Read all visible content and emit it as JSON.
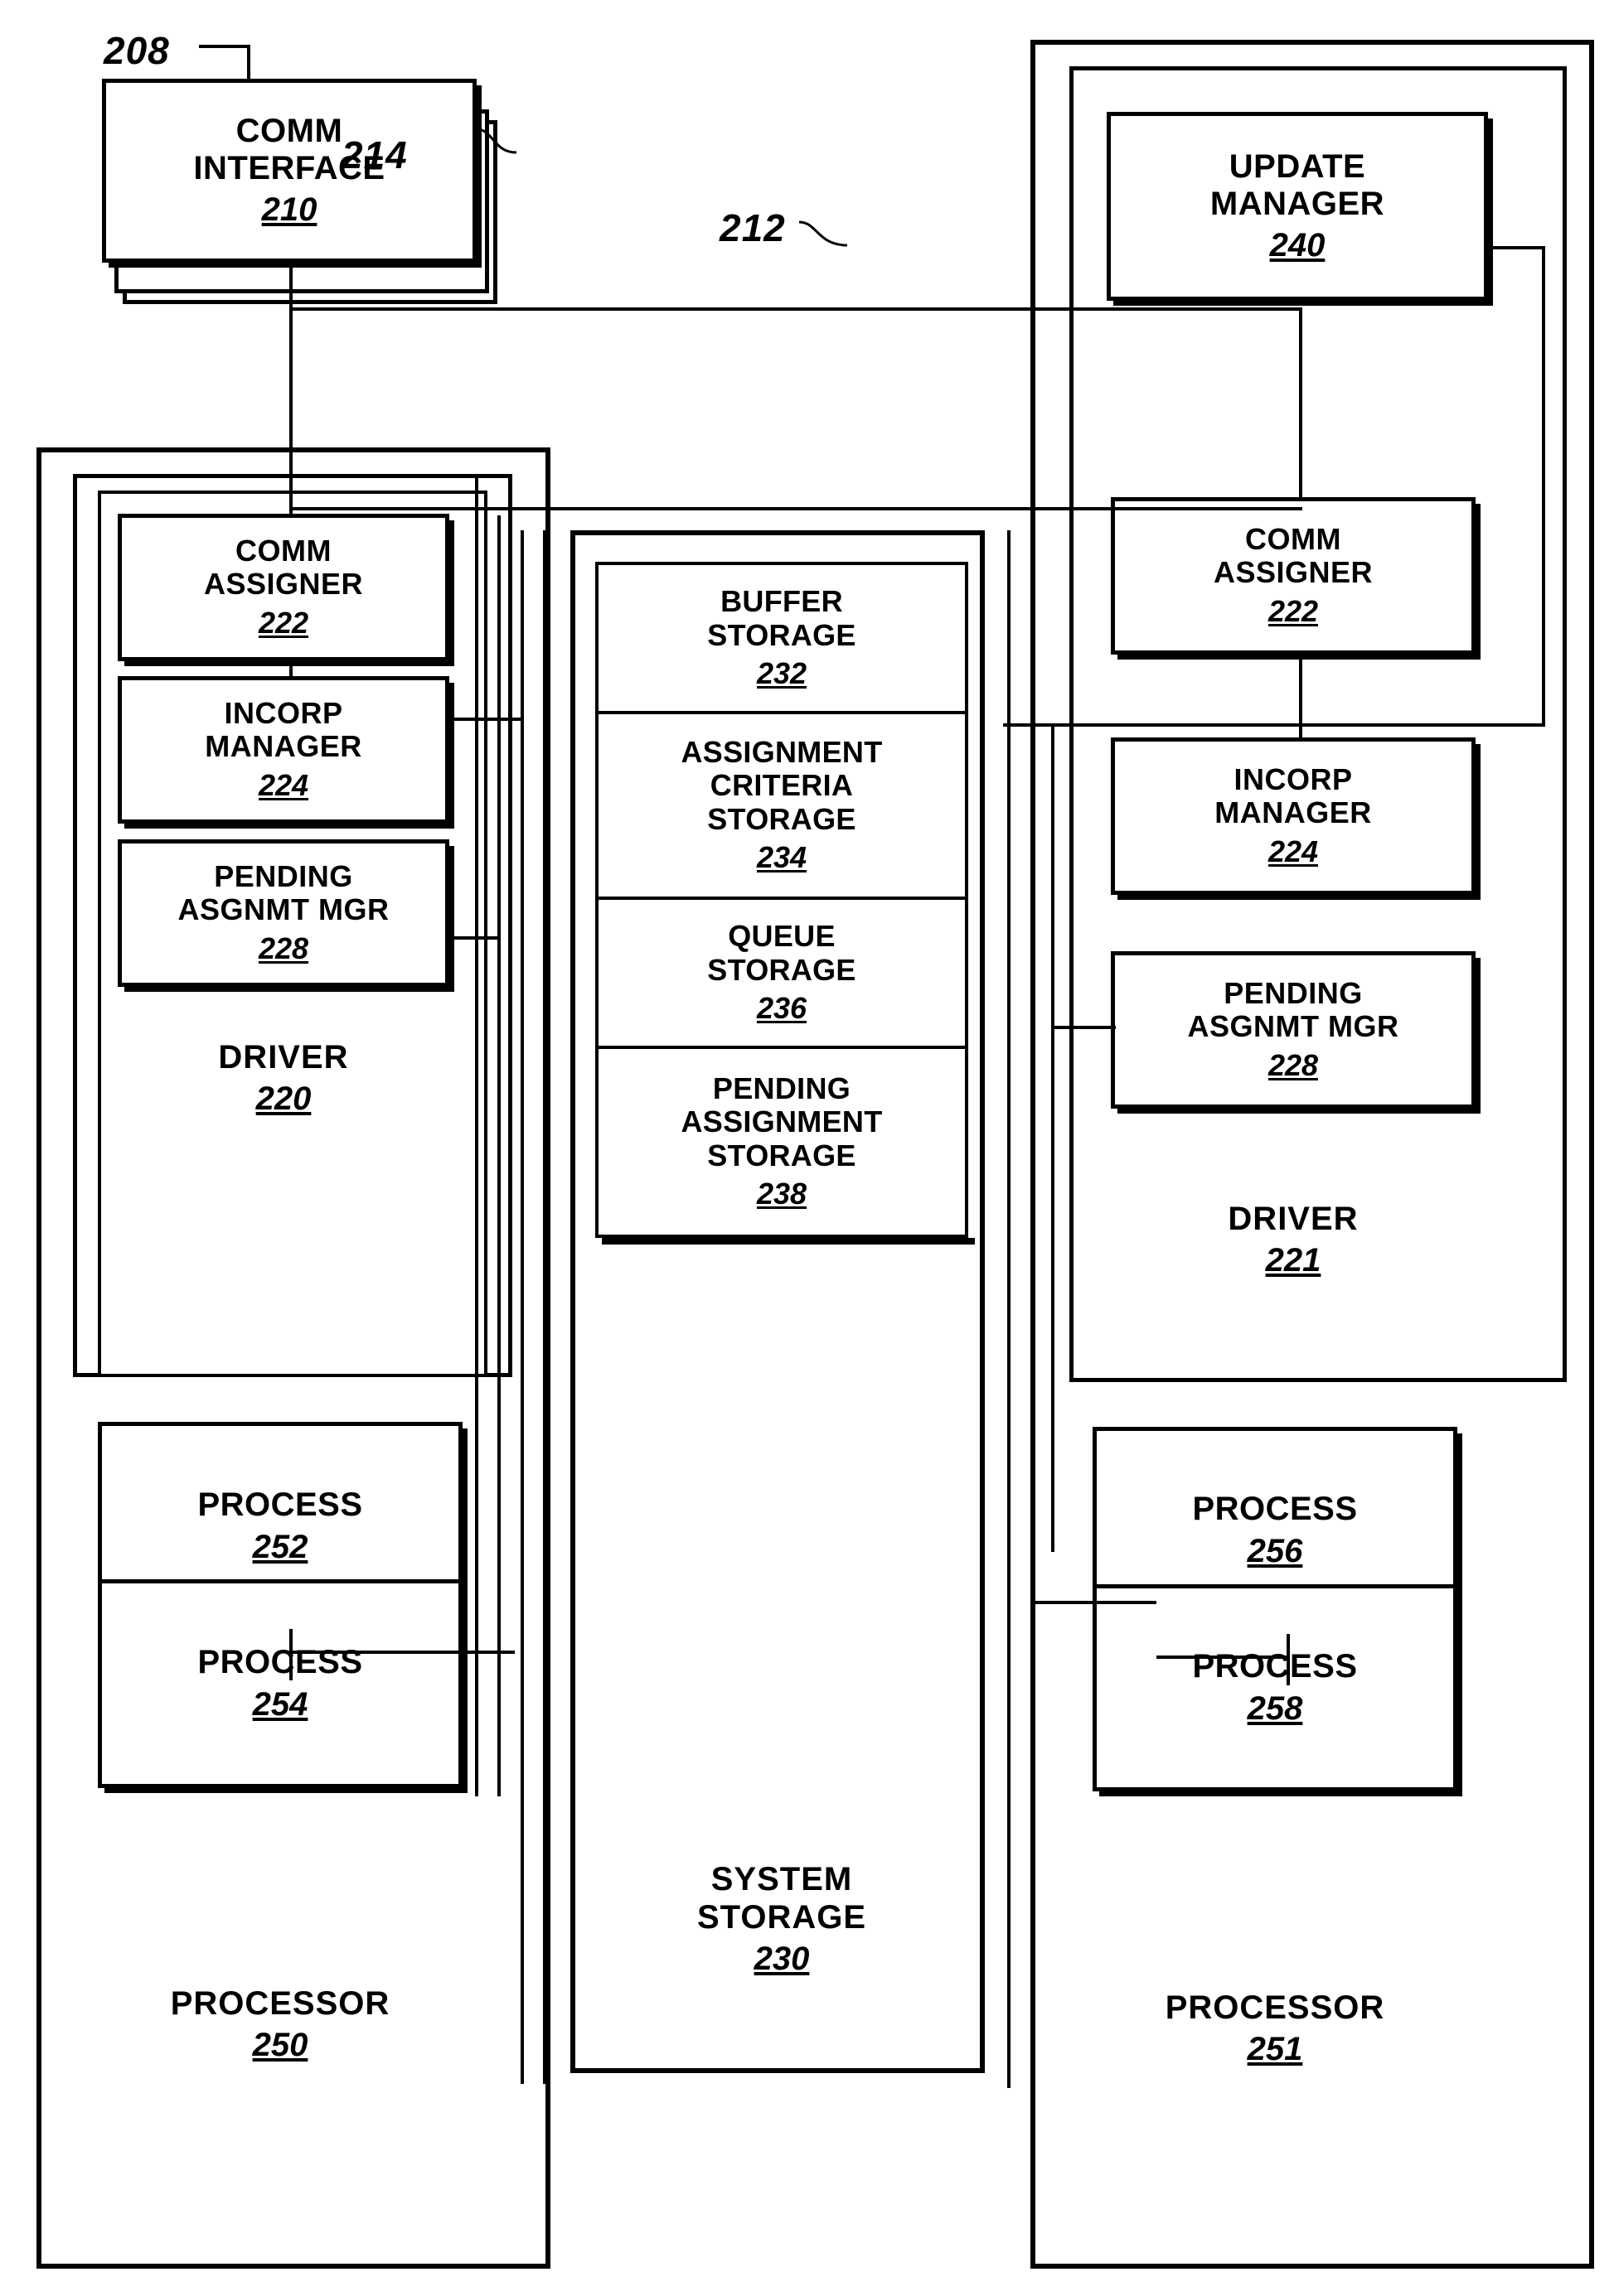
{
  "figure": {
    "callouts": [
      {
        "id": "208",
        "label": "208"
      },
      {
        "id": "212",
        "label": "212"
      },
      {
        "id": "214",
        "label": "214"
      }
    ]
  },
  "comm_interface": {
    "title": "COMM\nINTERFACE",
    "number": "210"
  },
  "update_manager": {
    "title": "UPDATE\nMANAGER",
    "number": "240"
  },
  "left_processor": {
    "caption_title": "PROCESSOR",
    "caption_number": "250",
    "driver": {
      "caption_title": "DRIVER",
      "caption_number": "220",
      "modules": [
        {
          "title": "COMM\nASSIGNER",
          "number": "222"
        },
        {
          "title": "INCORP\nMANAGER",
          "number": "224"
        },
        {
          "title": "PENDING\nASGNMT MGR",
          "number": "228"
        }
      ]
    },
    "processes": [
      {
        "title": "PROCESS",
        "number": "252"
      },
      {
        "title": "PROCESS",
        "number": "254"
      }
    ]
  },
  "right_processor": {
    "caption_title": "PROCESSOR",
    "caption_number": "251",
    "driver": {
      "caption_title": "DRIVER",
      "caption_number": "221",
      "modules": [
        {
          "title": "COMM\nASSIGNER",
          "number": "222"
        },
        {
          "title": "INCORP\nMANAGER",
          "number": "224"
        },
        {
          "title": "PENDING\nASGNMT MGR",
          "number": "228"
        }
      ]
    },
    "processes": [
      {
        "title": "PROCESS",
        "number": "256"
      },
      {
        "title": "PROCESS",
        "number": "258"
      }
    ]
  },
  "system_storage": {
    "caption_title": "SYSTEM\nSTORAGE",
    "caption_number": "230",
    "cells": [
      {
        "title": "BUFFER\nSTORAGE",
        "number": "232"
      },
      {
        "title": "ASSIGNMENT\nCRITERIA\nSTORAGE",
        "number": "234"
      },
      {
        "title": "QUEUE\nSTORAGE",
        "number": "236"
      },
      {
        "title": "PENDING\nASSIGNMENT\nSTORAGE",
        "number": "238"
      }
    ]
  },
  "colors": {
    "ink": "#000000",
    "paper": "#ffffff"
  }
}
